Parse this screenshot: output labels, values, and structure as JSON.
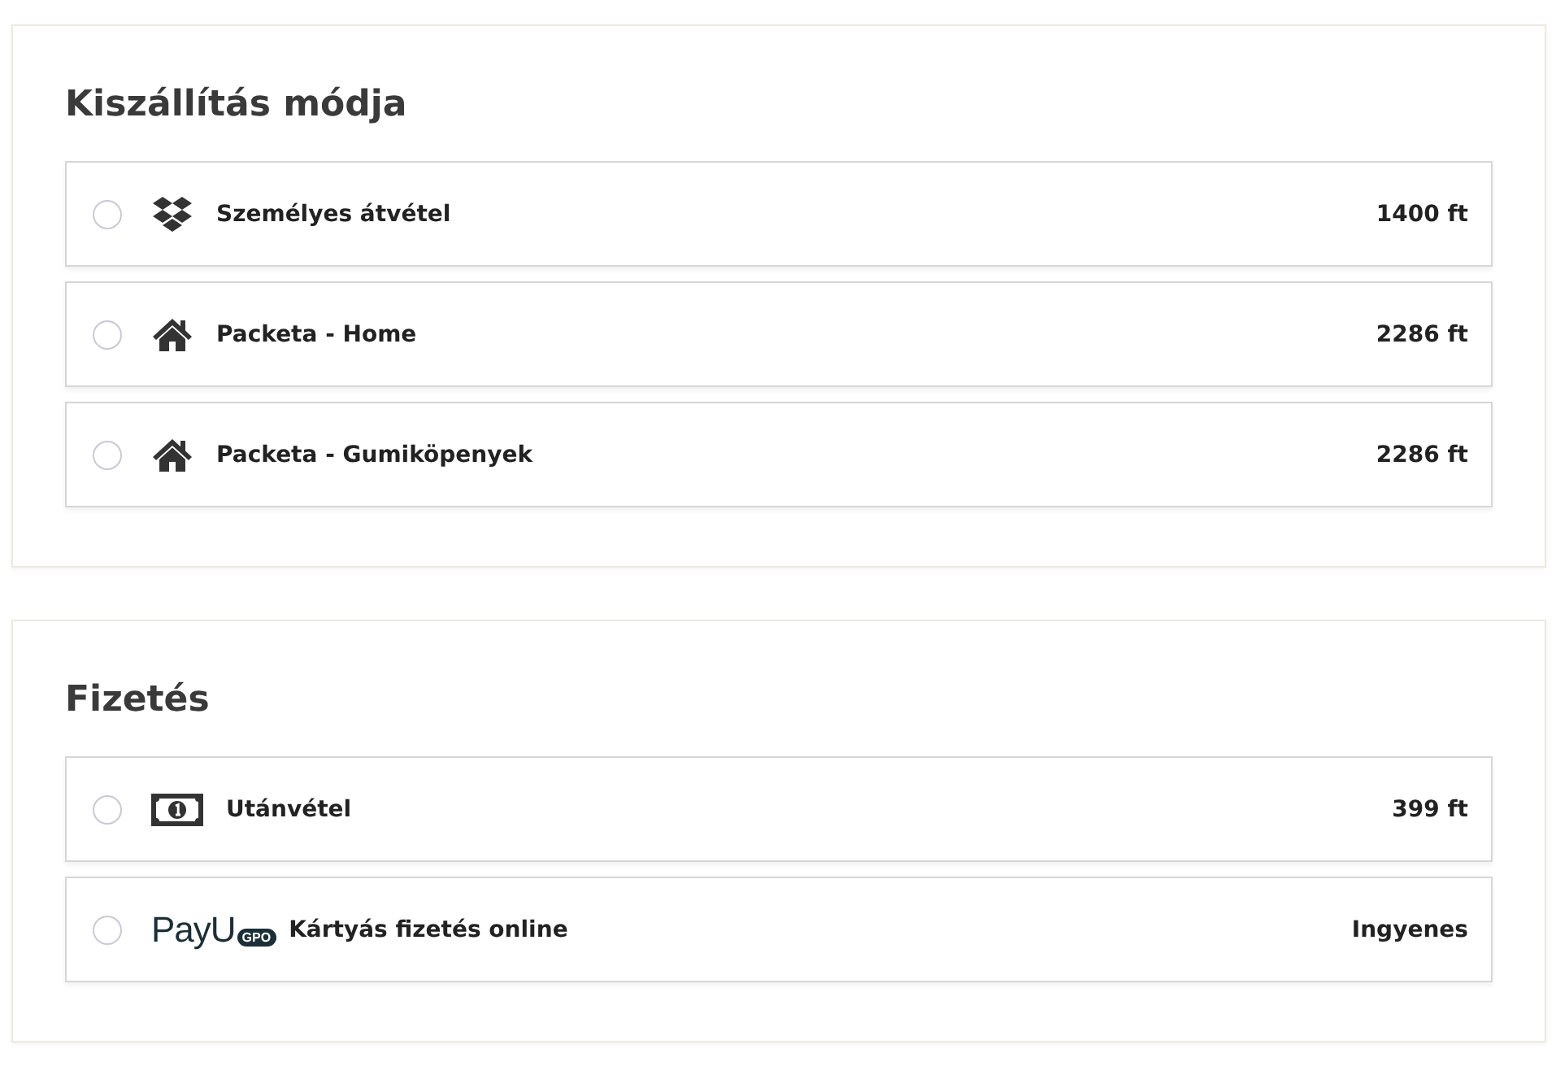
{
  "sections": [
    {
      "title": "Kiszállítás módja",
      "options": [
        {
          "kind": "box",
          "label": "Személyes átvétel",
          "price": "1400 ft",
          "selected": false
        },
        {
          "kind": "house",
          "label": "Packeta - Home",
          "price": "2286 ft",
          "selected": false
        },
        {
          "kind": "house",
          "label": "Packeta - Gumiköpenyek",
          "price": "2286 ft",
          "selected": false
        }
      ]
    },
    {
      "title": "Fizetés",
      "options": [
        {
          "kind": "cash",
          "label": "Utánvétel",
          "price": "399 ft",
          "selected": false
        },
        {
          "kind": "logo",
          "logo_text": "PayU",
          "logo_badge": "GPO",
          "label": "Kártyás fizetés online",
          "price": "Ingyenes",
          "selected": false
        }
      ]
    }
  ]
}
